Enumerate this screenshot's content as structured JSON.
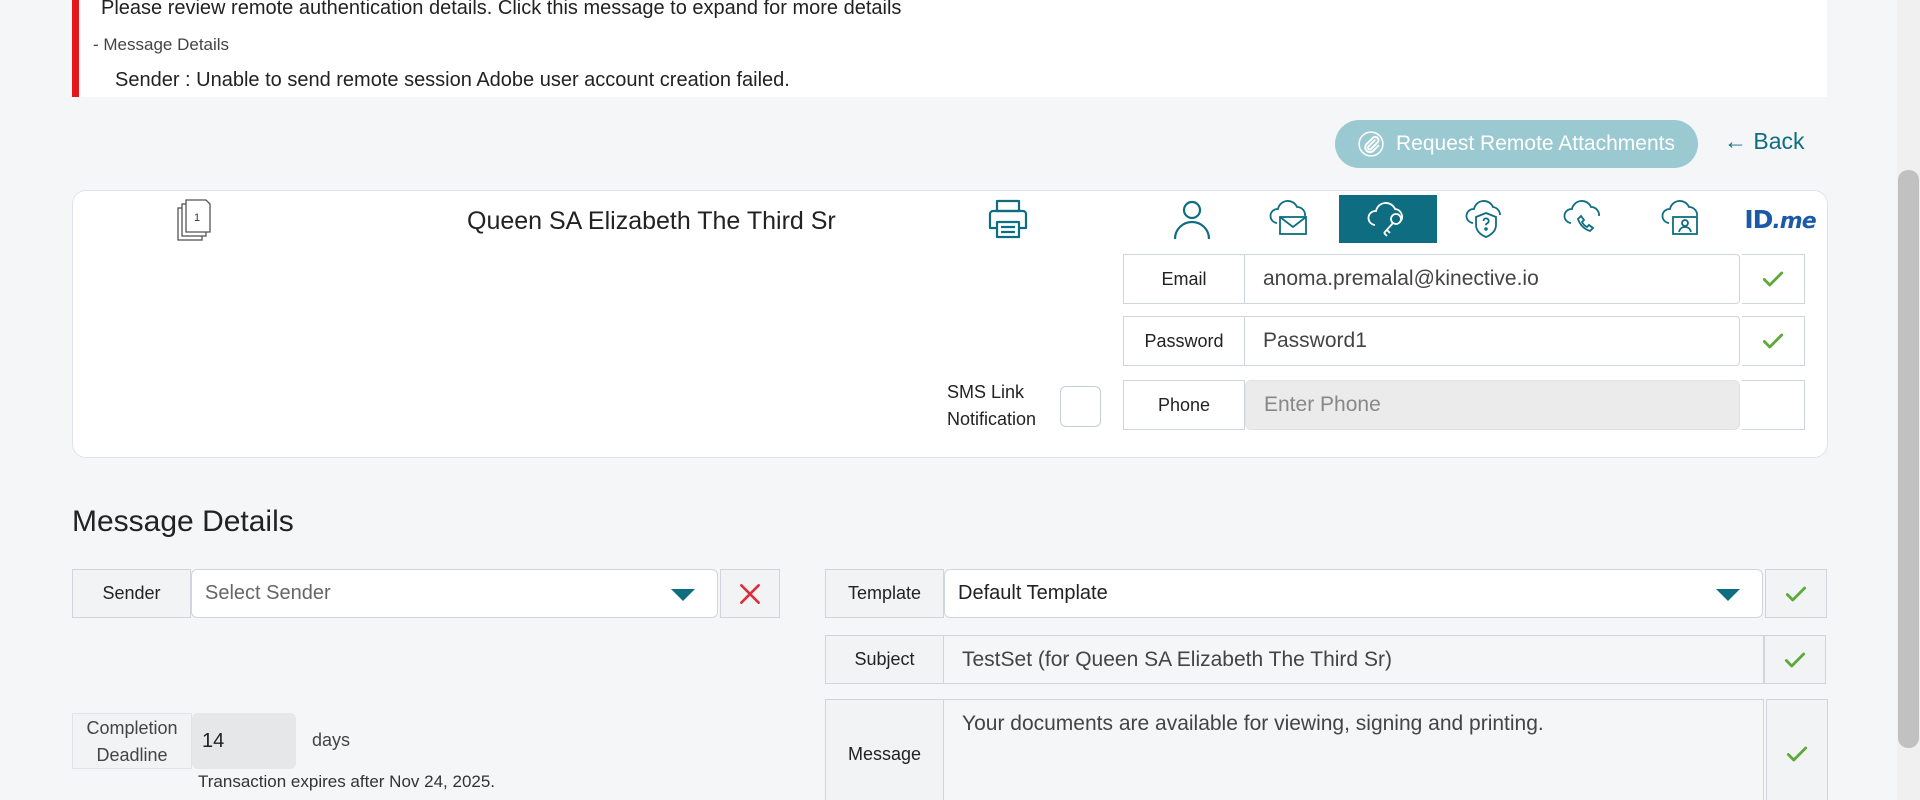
{
  "alert": {
    "summary": "Please review remote authentication details. Click this message to expand for more details",
    "details_toggle": "- Message Details",
    "detail_line": "Sender :  Unable to send remote session Adobe user account creation failed."
  },
  "actions": {
    "request_attachments_label": "Request Remote Attachments",
    "back_label": "← Back"
  },
  "signer": {
    "document_badge": "1",
    "name": "Queen SA Elizabeth The Third Sr",
    "auth_methods": [
      "person-icon",
      "email-cloud-icon",
      "password-key-icon",
      "security-question-icon",
      "phone-cloud-icon",
      "id-cloud-icon",
      "idme-logo"
    ],
    "active_method": "password-key-icon",
    "idme_logo": {
      "id": "ID",
      "me": ".me"
    },
    "email_label": "Email",
    "email_value": "anoma.premalal@kinective.io",
    "password_label": "Password",
    "password_value": "Password1",
    "phone_label": "Phone",
    "phone_placeholder": "Enter Phone",
    "sms_label_line1": "SMS Link",
    "sms_label_line2": "Notification",
    "sms_checked": false
  },
  "message_details": {
    "title": "Message Details",
    "sender_label": "Sender",
    "sender_placeholder": "Select Sender",
    "template_label": "Template",
    "template_value": "Default Template",
    "subject_label": "Subject",
    "subject_value": "TestSet (for Queen SA Elizabeth The Third Sr)",
    "message_label": "Message",
    "message_value": "Your documents are available for viewing, signing and printing.",
    "deadline_label_line1": "Completion",
    "deadline_label_line2": "Deadline",
    "deadline_value": "14",
    "deadline_unit": "days",
    "expires_text": "Transaction expires after Nov 24, 2025."
  },
  "colors": {
    "accent": "#0e6d80",
    "alert_border": "#e8141c",
    "check_green": "#5fa83a",
    "clear_red": "#d9303a",
    "pill_button": "#9bc9d1"
  }
}
